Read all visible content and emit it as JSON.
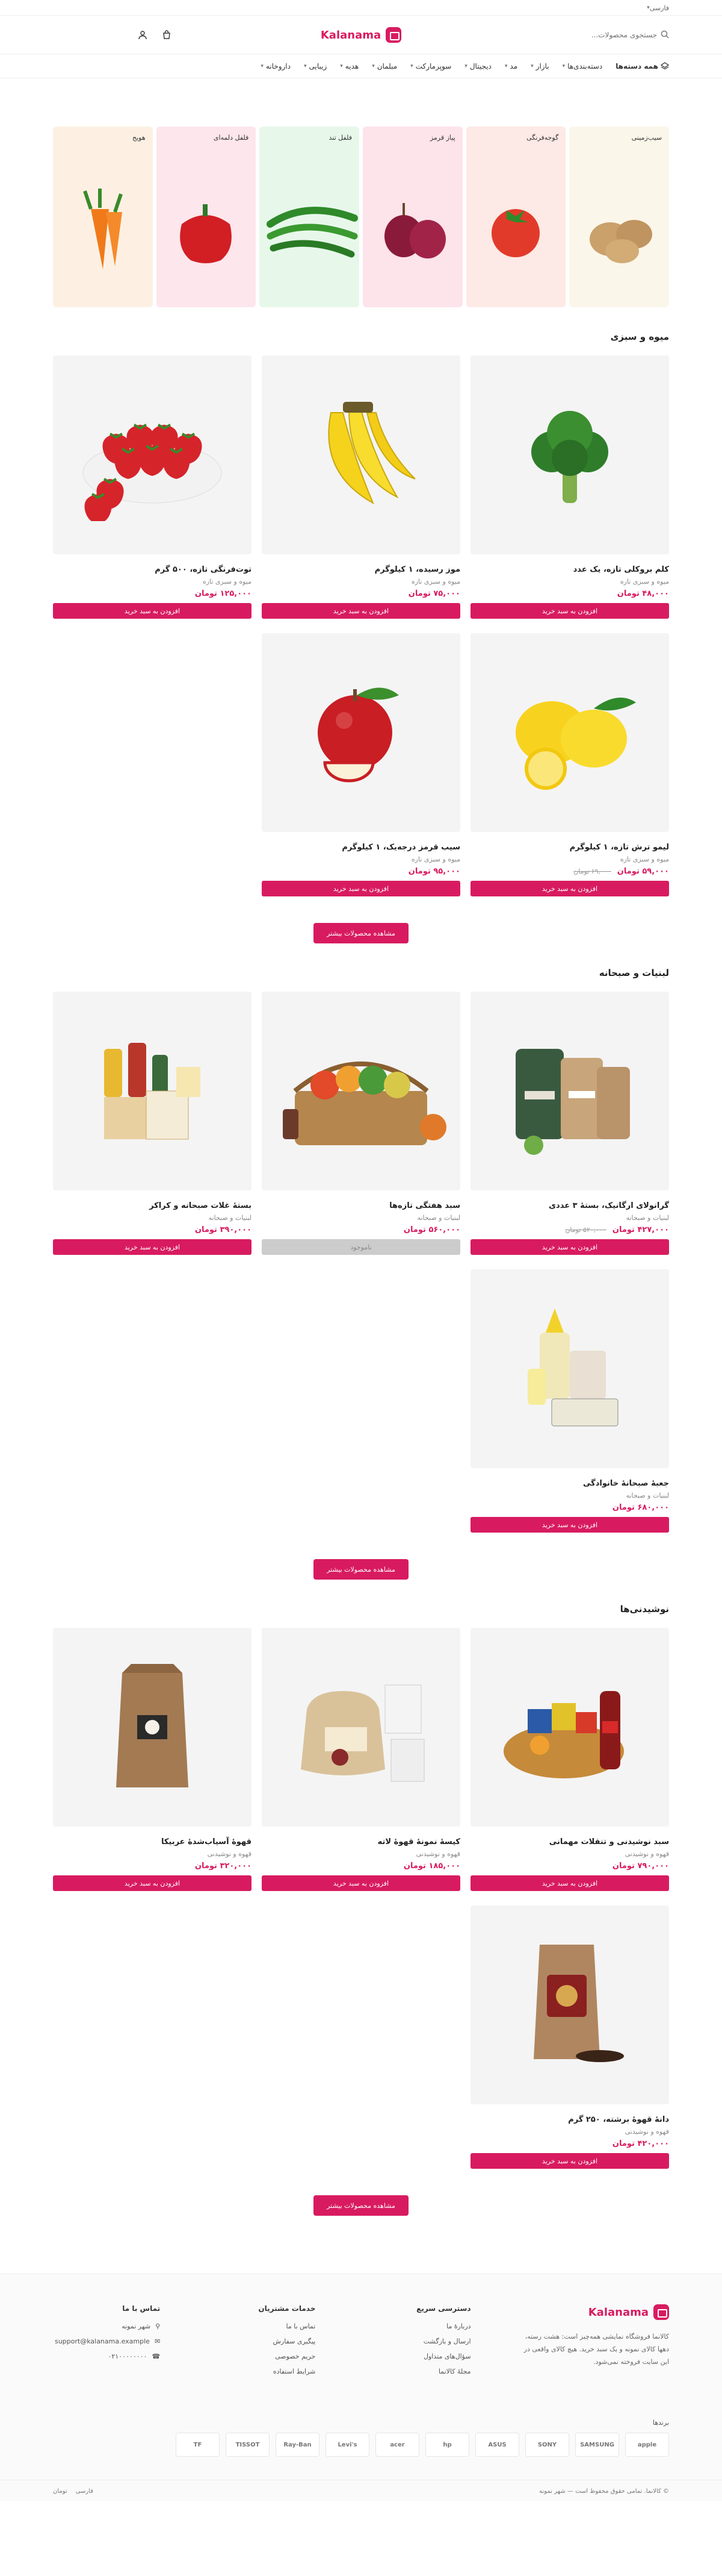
{
  "topbar": {
    "language": "فارسی"
  },
  "header": {
    "search_placeholder": "جستجوی محصولات...",
    "logo_text": "Kalanama"
  },
  "nav": {
    "all_label": "همه دسته‌ها",
    "items": [
      "دسته‌بندی‌ها",
      "بازار",
      "مد",
      "دیجیتال",
      "سوپرمارکت",
      "مبلمان",
      "هدیه",
      "زیبایی",
      "داروخانه"
    ]
  },
  "categories": [
    {
      "label": "سیب‌زمینی",
      "bg": "#fbf6ea"
    },
    {
      "label": "گوجه‌فرنگی",
      "bg": "#fde9e5"
    },
    {
      "label": "پیاز قرمز",
      "bg": "#fde3ea"
    },
    {
      "label": "فلفل تند",
      "bg": "#e7f8ea"
    },
    {
      "label": "فلفل دلمه‌ای",
      "bg": "#fde6ec"
    },
    {
      "label": "هویج",
      "bg": "#fdf0e3"
    }
  ],
  "sections": [
    {
      "title": "میوه و سبزی",
      "more": "مشاهده محصولات بیشتر",
      "products": [
        {
          "name": "کلم بروکلی تازه، یک عدد",
          "cat": "میوه و سبزی تازه",
          "price": "۴۸,۰۰۰ تومان",
          "old": "",
          "btn": "افزودن به سبد خرید",
          "img": "broccoli"
        },
        {
          "name": "موز رسیده، ۱ کیلوگرم",
          "cat": "میوه و سبزی تازه",
          "price": "۷۵,۰۰۰ تومان",
          "old": "",
          "btn": "افزودن به سبد خرید",
          "img": "banana"
        },
        {
          "name": "توت‌فرنگی تازه، ۵۰۰ گرم",
          "cat": "میوه و سبزی تازه",
          "price": "۱۲۵,۰۰۰ تومان",
          "old": "",
          "btn": "افزودن به سبد خرید",
          "img": "strawberry"
        },
        {
          "name": "لیمو ترش تازه، ۱ کیلوگرم",
          "cat": "میوه و سبزی تازه",
          "price": "۵۹,۰۰۰ تومان",
          "old": "۶۹,۰۰۰ تومان",
          "btn": "افزودن به سبد خرید",
          "img": "lemon"
        },
        {
          "name": "سیب قرمز درجه‌یک، ۱ کیلوگرم",
          "cat": "میوه و سبزی تازه",
          "price": "۹۵,۰۰۰ تومان",
          "old": "",
          "btn": "افزودن به سبد خرید",
          "img": "apple"
        }
      ]
    },
    {
      "title": "لبنیات و صبحانه",
      "more": "مشاهده محصولات بیشتر",
      "products": [
        {
          "name": "گرانولای ارگانیک، بستهٔ ۳ عددی",
          "cat": "لبنیات و صبحانه",
          "price": "۴۲۷,۰۰۰ تومان",
          "old": "۵۲۰,۰۰۰ تومان",
          "btn": "افزودن به سبد خرید",
          "img": "granola"
        },
        {
          "name": "سبد هفتگی تازه‌ها",
          "cat": "لبنیات و صبحانه",
          "price": "۵۶۰,۰۰۰ تومان",
          "old": "",
          "btn": "ناموجود",
          "img": "basket",
          "disabled": true
        },
        {
          "name": "بستهٔ غلات صبحانه و کراکر",
          "cat": "لبنیات و صبحانه",
          "price": "۳۹۰,۰۰۰ تومان",
          "old": "",
          "btn": "افزودن به سبد خرید",
          "img": "cereal"
        },
        {
          "name": "جعبهٔ صبحانهٔ خانوادگی",
          "cat": "لبنیات و صبحانه",
          "price": "۶۸۰,۰۰۰ تومان",
          "old": "",
          "btn": "افزودن به سبد خرید",
          "img": "waffles"
        }
      ]
    },
    {
      "title": "نوشیدنی‌ها",
      "more": "مشاهده محصولات بیشتر",
      "products": [
        {
          "name": "سبد نوشیدنی و تنقلات مهمانی",
          "cat": "قهوه و نوشیدنی",
          "price": "۷۹۰,۰۰۰ تومان",
          "old": "",
          "btn": "افزودن به سبد خرید",
          "img": "snacks"
        },
        {
          "name": "کیسهٔ نمونهٔ قهوهٔ لاته",
          "cat": "قهوه و نوشیدنی",
          "price": "۱۸۵,۰۰۰ تومان",
          "old": "",
          "btn": "افزودن به سبد خرید",
          "img": "sack"
        },
        {
          "name": "قهوهٔ آسیاب‌شدهٔ عربیکا",
          "cat": "قهوه و نوشیدنی",
          "price": "۳۲۰,۰۰۰ تومان",
          "old": "",
          "btn": "افزودن به سبد خرید",
          "img": "coffeebag"
        },
        {
          "name": "دانهٔ قهوهٔ برشته، ۲۵۰ گرم",
          "cat": "قهوه و نوشیدنی",
          "price": "۴۲۰,۰۰۰ تومان",
          "old": "",
          "btn": "افزودن به سبد خرید",
          "img": "kraft"
        }
      ]
    }
  ],
  "footer": {
    "about": "کالانما فروشگاه نمایشی همه‌چیز است: هشت رسته، دهها کالای نمونه و یک سبد خرید. هیچ کالای واقعی در این سایت فروخته نمی‌شود.",
    "col1_title": "دسترسی سریع",
    "col1_links": [
      "دربارهٔ ما",
      "ارسال و بازگشت",
      "سؤال‌های متداول",
      "مجلهٔ کالانما"
    ],
    "col2_title": "خدمات مشتریان",
    "col2_links": [
      "تماس با ما",
      "پیگیری سفارش",
      "حریم خصوصی",
      "شرایط استفاده"
    ],
    "col3_title": "تماس با ما",
    "address": "شهر نمونه",
    "email": "support@kalanama.example",
    "phone": "۰۲۱۰۰۰۰۰۰۰۰",
    "brands_title": "برندها",
    "brands": [
      "apple",
      "SAMSUNG",
      "SONY",
      "ASUS",
      "hp",
      "acer",
      "Levi's",
      "Ray-Ban",
      "TISSOT",
      "TF"
    ],
    "copyright": "© کالانما. تمامی حقوق محفوظ است — شهر نمونه",
    "lang": "فارسی",
    "currency": "تومان"
  },
  "colors": {
    "accent": "#d81b60"
  }
}
